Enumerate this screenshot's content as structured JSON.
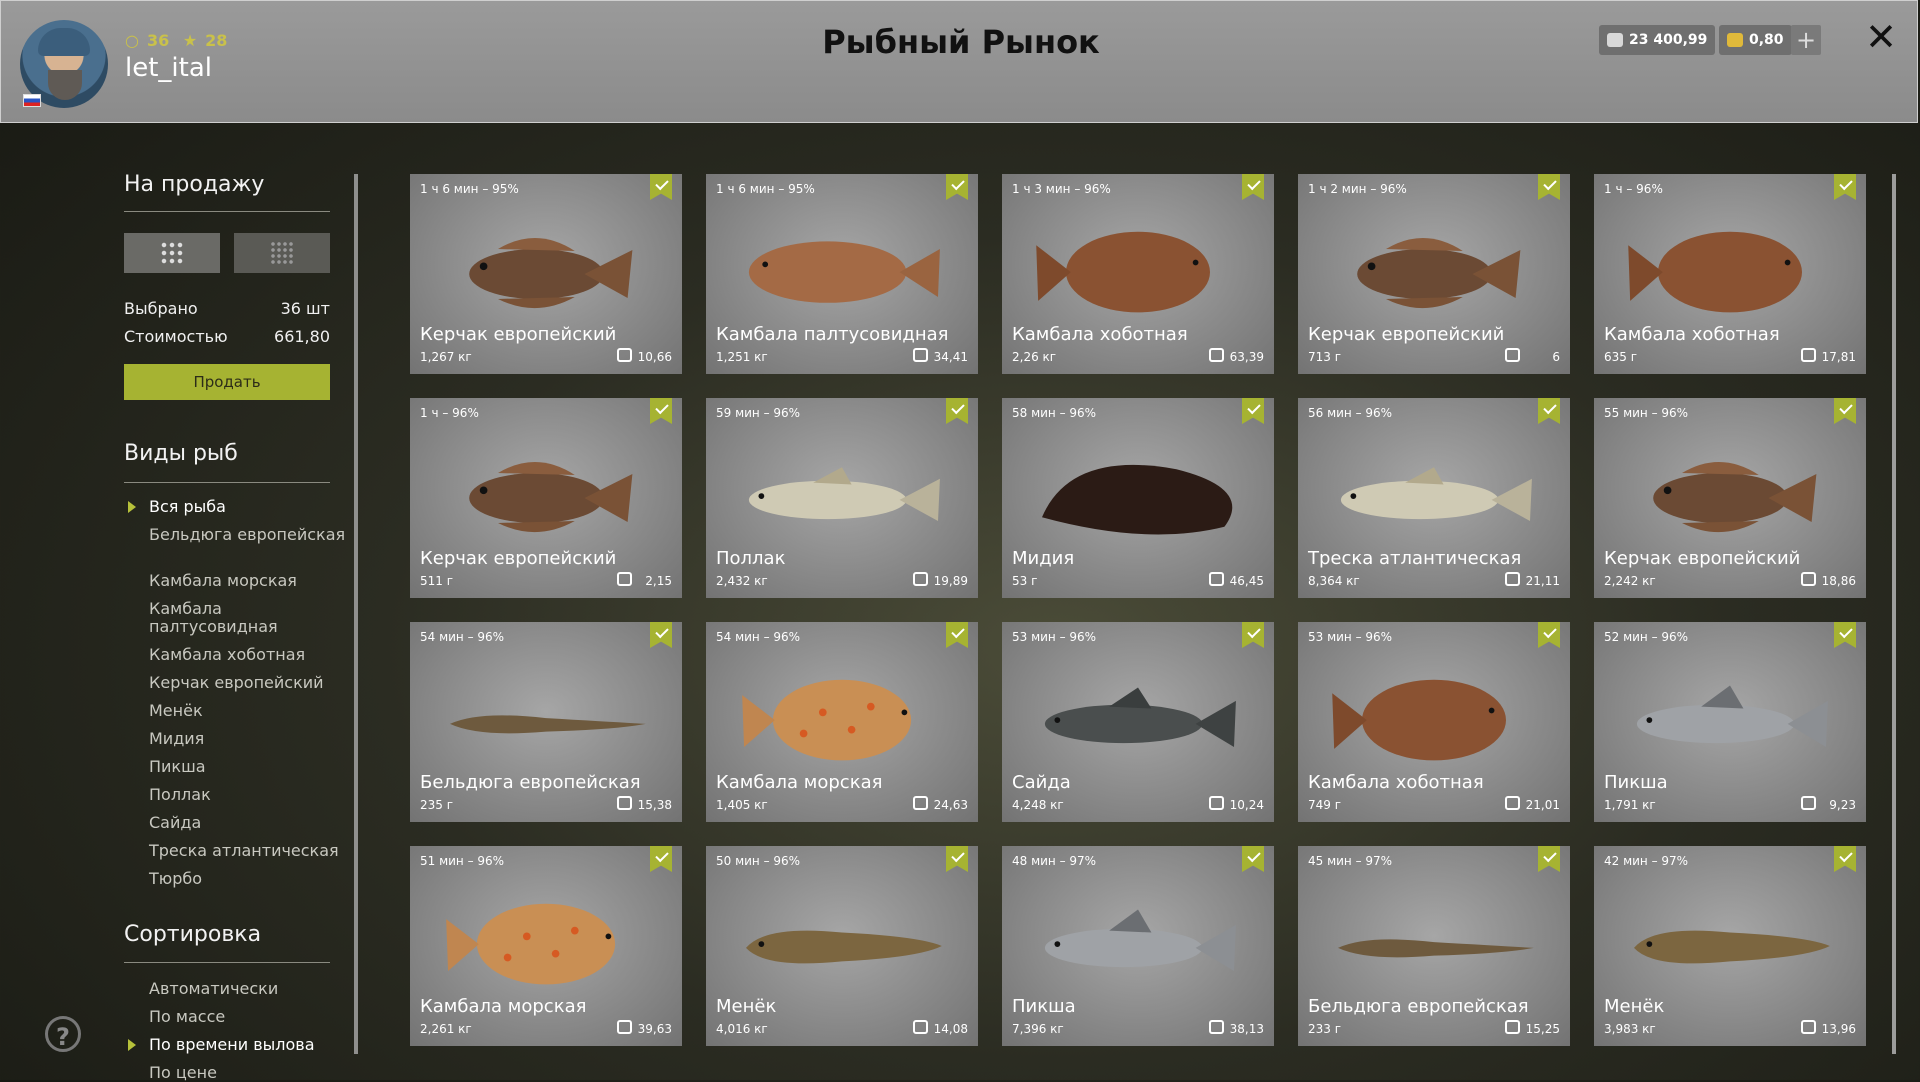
{
  "header": {
    "title": "Рыбный Рынок",
    "username": "let_ital",
    "level": "36",
    "stars": "28",
    "silver": "23 400,99",
    "gold": "0,80",
    "plus": "+",
    "close": "✕"
  },
  "sidebar": {
    "sale_heading": "На продажу",
    "selected_label": "Выбрано",
    "selected_value": "36 шт",
    "cost_label": "Стоимостью",
    "cost_value": "661,80",
    "sell_button": "Продать",
    "species_heading": "Виды рыб",
    "species": [
      "Вся рыба",
      "Бельдюга европейская",
      "Камбала морская",
      "Камбала палтусовидная",
      "Камбала хоботная",
      "Керчак европейский",
      "Менёк",
      "Мидия",
      "Пикша",
      "Поллак",
      "Сайда",
      "Треска атлантическая",
      "Тюрбо"
    ],
    "sort_heading": "Сортировка",
    "sort_options": [
      "Автоматически",
      "По массе",
      "По времени вылова",
      "По цене"
    ],
    "help": "?"
  },
  "colors": {
    "accent": "#a6b332",
    "card_bg": "#8a8a8a",
    "header_bg": "#949494"
  },
  "cards": [
    {
      "time": "1 ч 6 мин – 95%",
      "name": "Керчак европейский",
      "weight": "1,267 кг",
      "price": "10,66",
      "fish": "sculpin"
    },
    {
      "time": "1 ч 6 мин – 95%",
      "name": "Камбала палтусовидная",
      "weight": "1,251 кг",
      "price": "34,41",
      "fish": "flatfish-plain"
    },
    {
      "time": "1 ч 3 мин – 96%",
      "name": "Камбала хоботная",
      "weight": "2,26 кг",
      "price": "63,39",
      "fish": "flatfish-round"
    },
    {
      "time": "1 ч 2 мин – 96%",
      "name": "Керчак европейский",
      "weight": "713 г",
      "price": "6",
      "fish": "sculpin"
    },
    {
      "time": "1 ч – 96%",
      "name": "Камбала хоботная",
      "weight": "635 г",
      "price": "17,81",
      "fish": "flatfish-round"
    },
    {
      "time": "1 ч – 96%",
      "name": "Керчак европейский",
      "weight": "511 г",
      "price": "2,15",
      "fish": "sculpin"
    },
    {
      "time": "59 мин – 96%",
      "name": "Поллак",
      "weight": "2,432 кг",
      "price": "19,89",
      "fish": "cod-pale"
    },
    {
      "time": "58 мин – 96%",
      "name": "Мидия",
      "weight": "53 г",
      "price": "46,45",
      "fish": "mussel"
    },
    {
      "time": "56 мин – 96%",
      "name": "Треска атлантическая",
      "weight": "8,364 кг",
      "price": "21,11",
      "fish": "cod-pale"
    },
    {
      "time": "55 мин – 96%",
      "name": "Керчак европейский",
      "weight": "2,242 кг",
      "price": "18,86",
      "fish": "sculpin"
    },
    {
      "time": "54 мин – 96%",
      "name": "Бельдюга европейская",
      "weight": "235 г",
      "price": "15,38",
      "fish": "eelpout"
    },
    {
      "time": "54 мин – 96%",
      "name": "Камбала морская",
      "weight": "1,405 кг",
      "price": "24,63",
      "fish": "plaice"
    },
    {
      "time": "53 мин – 96%",
      "name": "Сайда",
      "weight": "4,248 кг",
      "price": "10,24",
      "fish": "cod-dark"
    },
    {
      "time": "53 мин – 96%",
      "name": "Камбала хоботная",
      "weight": "749 г",
      "price": "21,01",
      "fish": "flatfish-round"
    },
    {
      "time": "52 мин – 96%",
      "name": "Пикша",
      "weight": "1,791 кг",
      "price": "9,23",
      "fish": "cod-silver"
    },
    {
      "time": "51 мин – 96%",
      "name": "Камбала морская",
      "weight": "2,261 кг",
      "price": "39,63",
      "fish": "plaice"
    },
    {
      "time": "50 мин – 96%",
      "name": "Менёк",
      "weight": "4,016 кг",
      "price": "14,08",
      "fish": "tusk"
    },
    {
      "time": "48 мин – 97%",
      "name": "Пикша",
      "weight": "7,396 кг",
      "price": "38,13",
      "fish": "cod-silver"
    },
    {
      "time": "45 мин – 97%",
      "name": "Бельдюга европейская",
      "weight": "233 г",
      "price": "15,25",
      "fish": "eelpout"
    },
    {
      "time": "42 мин – 97%",
      "name": "Менёк",
      "weight": "3,983 кг",
      "price": "13,96",
      "fish": "tusk"
    }
  ]
}
